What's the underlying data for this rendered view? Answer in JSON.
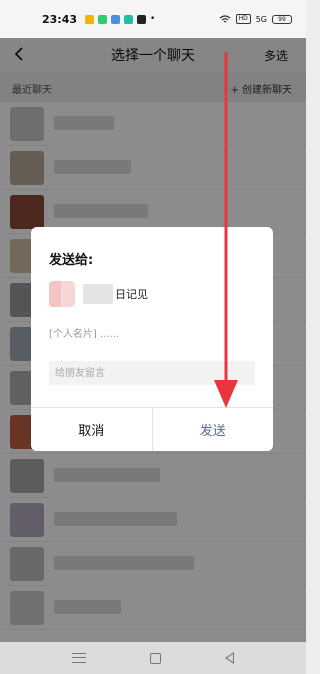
{
  "status_bar": {
    "time": "23:43",
    "network_badge": "HD",
    "signal_text": "5G",
    "battery": "99"
  },
  "nav": {
    "back_icon": "chevron-left-icon",
    "title": "选择一个聊天",
    "multi_select": "多选"
  },
  "list_section": {
    "recent_label": "最近聊天",
    "new_chat_label": "+ 创建新聊天"
  },
  "chat_list": {
    "peek_text": "...",
    "rows": [
      {
        "name": "",
        "avatar_color": "#c8c8c8"
      },
      {
        "name": "",
        "avatar_color": "#b8a89a"
      },
      {
        "name": "",
        "avatar_color": "#8b4a3a"
      },
      {
        "name": "",
        "avatar_color": "#d4c0a0"
      },
      {
        "name": "",
        "avatar_color": "#9a9a9a"
      },
      {
        "name": "",
        "avatar_color": "#a0a8b4"
      },
      {
        "name": "",
        "avatar_color": "#b0b0b0"
      },
      {
        "name": "",
        "avatar_color": "#c06040"
      },
      {
        "name": "",
        "avatar_color": "#a8a8a8"
      },
      {
        "name": "",
        "avatar_color": "#b4a8c0"
      },
      {
        "name": "",
        "avatar_color": "#c0c0c0"
      },
      {
        "name": "",
        "avatar_color": "#cccccc"
      }
    ]
  },
  "dialog": {
    "title": "发送给:",
    "recipient_name": "日记见",
    "card_preview": "[个人名片] ......",
    "message_placeholder": "给朋友留言",
    "cancel_label": "取消",
    "send_label": "发送"
  },
  "colors": {
    "send_accent": "#576b95",
    "annotation_arrow": "#e8363c"
  }
}
